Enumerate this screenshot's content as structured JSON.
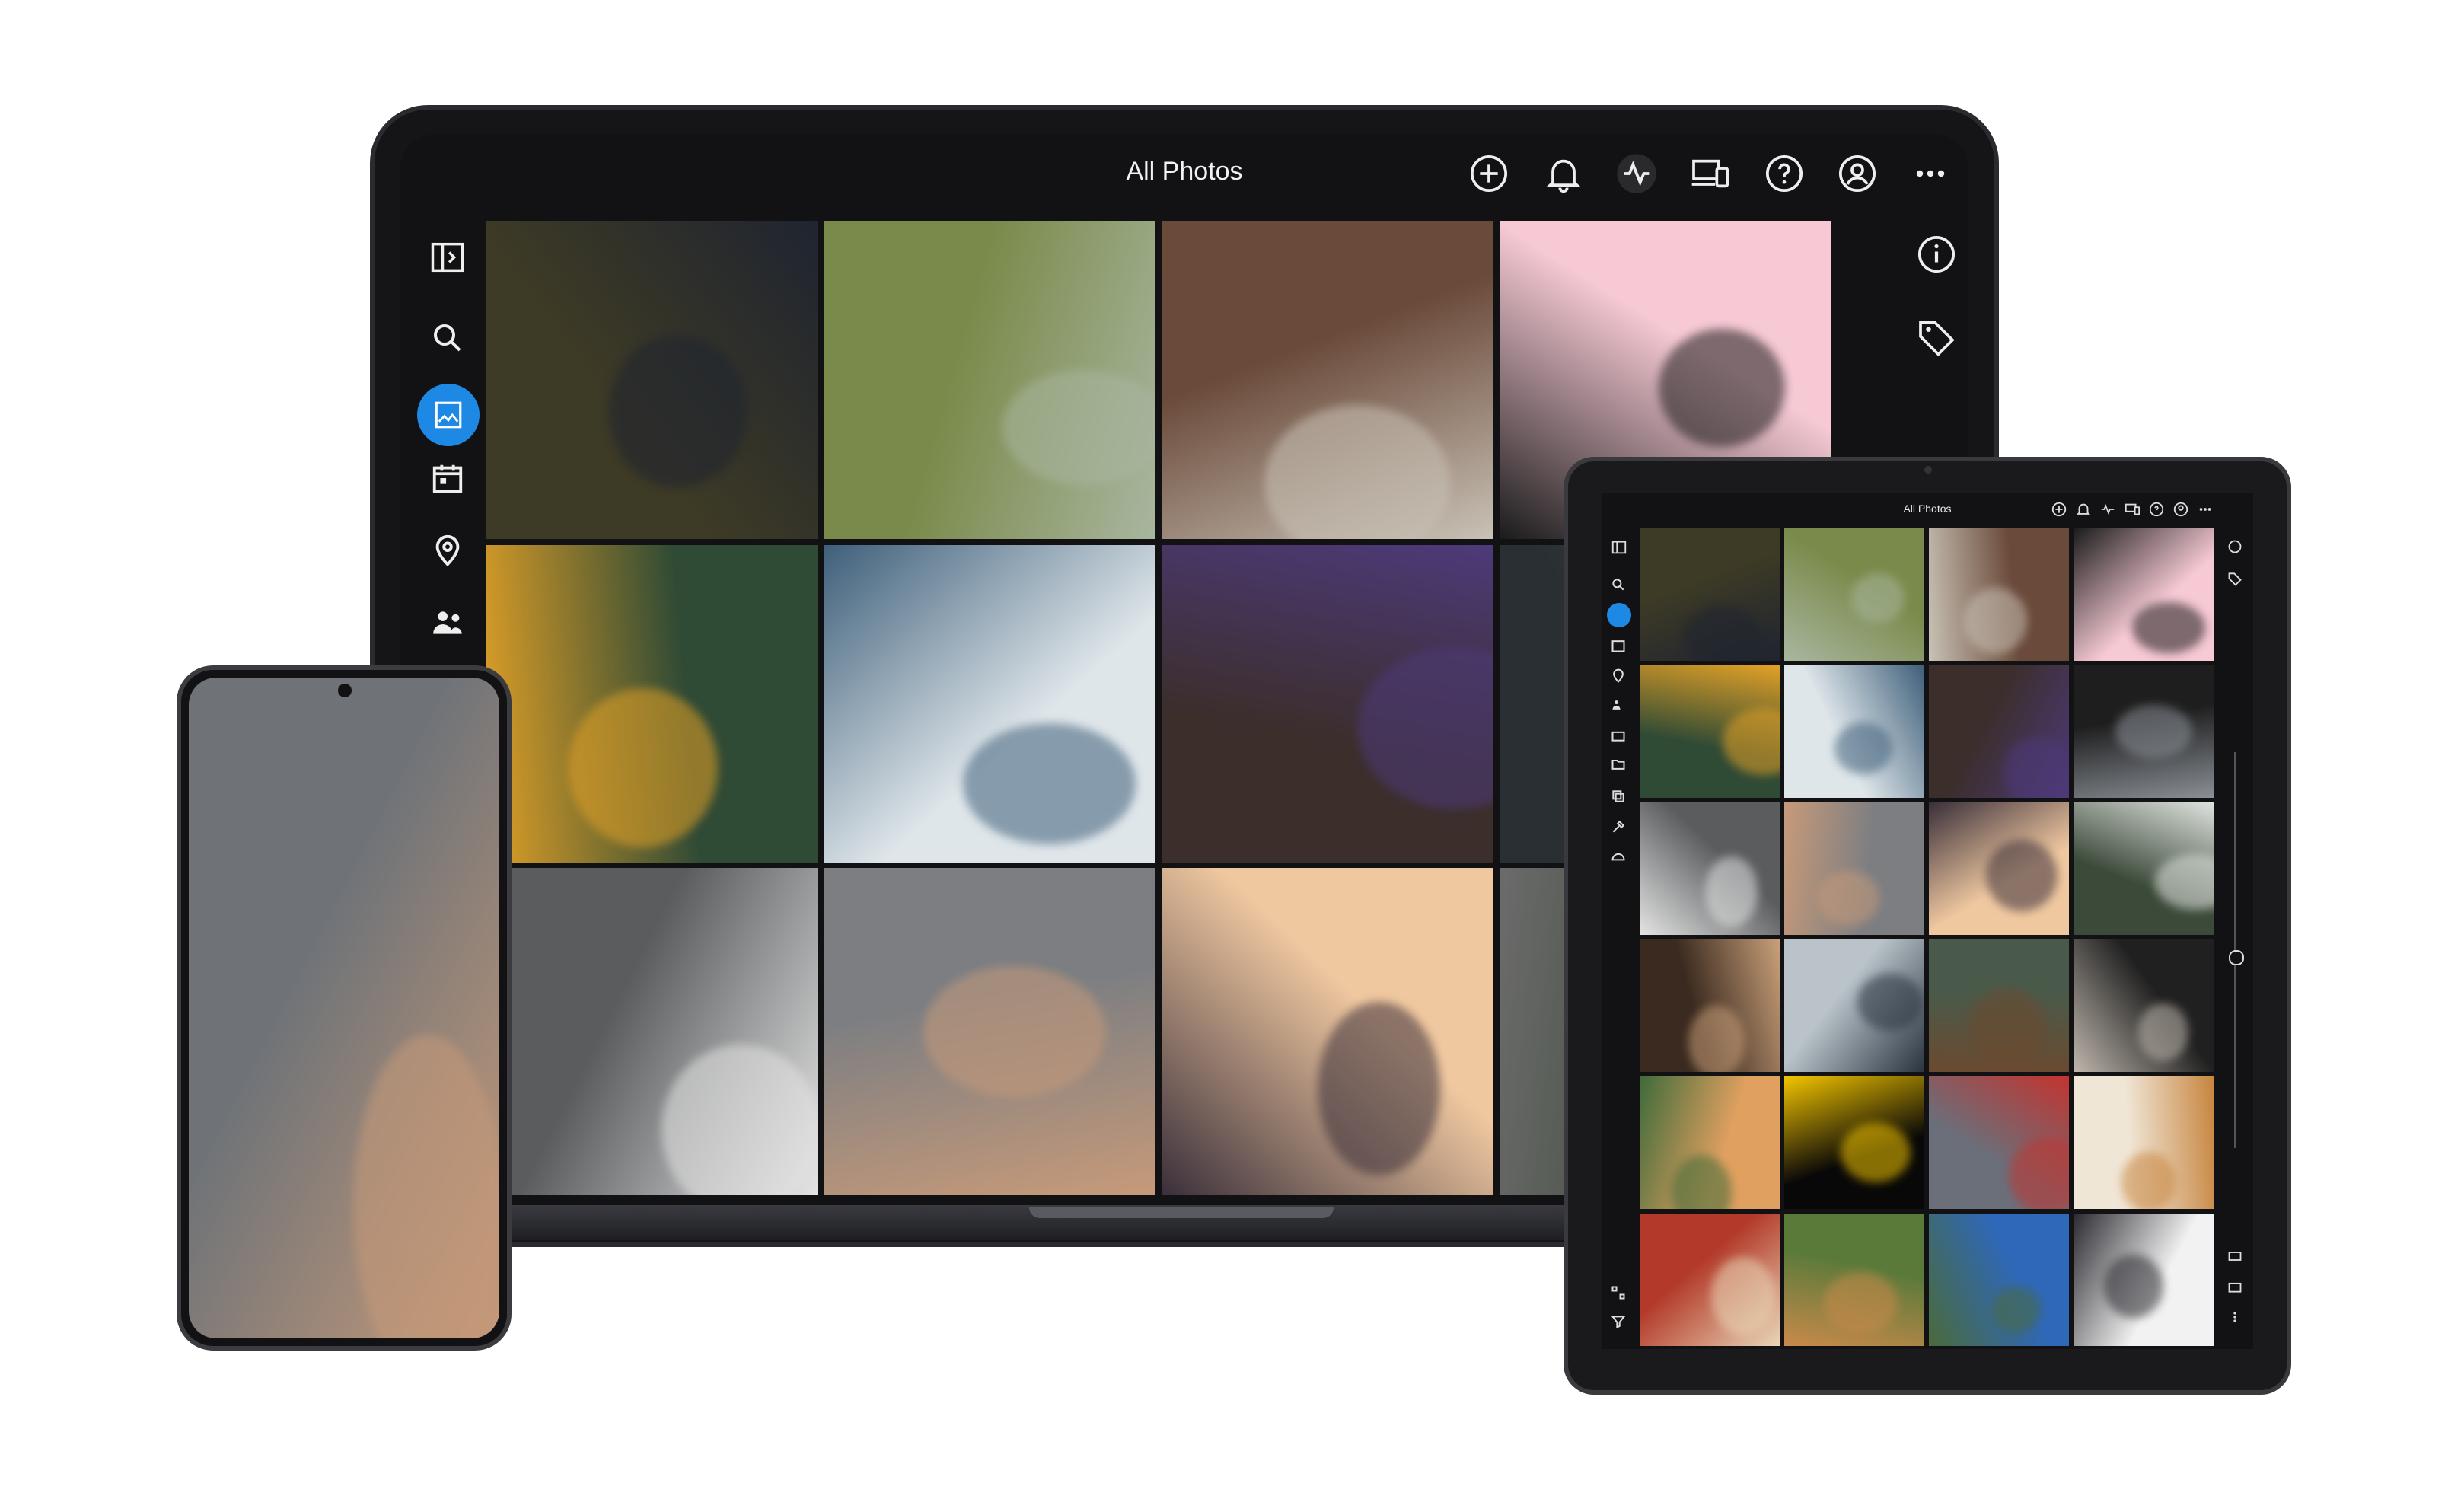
{
  "app": {
    "title": "All Photos",
    "accent": "#1e88e5"
  },
  "laptop": {
    "toolbar_icons": [
      "add-icon",
      "bell-icon",
      "activity-icon",
      "devices-icon",
      "help-icon",
      "account-icon",
      "more-icon"
    ],
    "sidebar_icons": [
      "sidebar-toggle-icon",
      "search-icon",
      "photos-icon",
      "calendar-icon",
      "location-icon",
      "people-icon"
    ],
    "right_icons": [
      "info-icon",
      "tag-icon"
    ],
    "photos": [
      {
        "name": "photo-bag-plant",
        "c1": "#3d3a25",
        "c2": "#1f2430"
      },
      {
        "name": "photo-woman-field",
        "c1": "#7a8a4a",
        "c2": "#a9b6a0"
      },
      {
        "name": "photo-white-dog",
        "c1": "#6a4a3a",
        "c2": "#c9c2b6"
      },
      {
        "name": "photo-camera-pink",
        "c1": "#f6c9d4",
        "c2": "#1b1b1b"
      },
      {
        "name": "photo-autumn-leaf",
        "c1": "#2f4a35",
        "c2": "#e3a126"
      },
      {
        "name": "photo-surfer-wave",
        "c1": "#dfe6ea",
        "c2": "#3e5f7a"
      },
      {
        "name": "photo-purple-flowers",
        "c1": "#3b2e2b",
        "c2": "#4d3a7a"
      },
      {
        "name": "photo-partial",
        "c1": "#2a2f33",
        "c2": "#4a5056"
      },
      {
        "name": "photo-sneaker-splash",
        "c1": "#5a5c5e",
        "c2": "#e4e4e4"
      },
      {
        "name": "photo-woman-frame",
        "c1": "#7c7e82",
        "c2": "#c79a79"
      },
      {
        "name": "photo-concert-light",
        "c1": "#f0c8a0",
        "c2": "#3a2f3a"
      },
      {
        "name": "photo-partial-2",
        "c1": "#3d4a3a",
        "c2": "#6b6b6b"
      }
    ]
  },
  "tablet": {
    "title": "All Photos",
    "photos": [
      {
        "name": "t-photo-1",
        "c1": "#3d3a25",
        "c2": "#1f2430"
      },
      {
        "name": "t-photo-2",
        "c1": "#7a8a4a",
        "c2": "#a9b6a0"
      },
      {
        "name": "t-photo-3",
        "c1": "#6a4a3a",
        "c2": "#c9c2b6"
      },
      {
        "name": "t-photo-4",
        "c1": "#f6c9d4",
        "c2": "#1b1b1b"
      },
      {
        "name": "t-photo-5",
        "c1": "#2f4a35",
        "c2": "#e3a126"
      },
      {
        "name": "t-photo-6",
        "c1": "#dfe6ea",
        "c2": "#3e5f7a"
      },
      {
        "name": "t-photo-7",
        "c1": "#3b2e2b",
        "c2": "#4d3a7a"
      },
      {
        "name": "t-photo-8",
        "c1": "#1e1e1e",
        "c2": "#8a8f96"
      },
      {
        "name": "t-photo-9",
        "c1": "#5a5c5e",
        "c2": "#e4e4e4"
      },
      {
        "name": "t-photo-10",
        "c1": "#7c7e82",
        "c2": "#c79a79"
      },
      {
        "name": "t-photo-11",
        "c1": "#f0c8a0",
        "c2": "#3a2f3a"
      },
      {
        "name": "t-photo-12",
        "c1": "#3c4a3a",
        "c2": "#dfe3de"
      },
      {
        "name": "t-photo-13",
        "c1": "#3a2a1f",
        "c2": "#caa07a"
      },
      {
        "name": "t-photo-14",
        "c1": "#b9c3c9",
        "c2": "#2a3440"
      },
      {
        "name": "t-photo-15",
        "c1": "#4a5a4a",
        "c2": "#6b4a30"
      },
      {
        "name": "t-photo-16",
        "c1": "#202020",
        "c2": "#bfb7ad"
      },
      {
        "name": "t-photo-17",
        "c1": "#e0a060",
        "c2": "#3e6b3a"
      },
      {
        "name": "t-photo-18",
        "c1": "#080808",
        "c2": "#f2c400"
      },
      {
        "name": "t-photo-19",
        "c1": "#6a6f7a",
        "c2": "#c3342f"
      },
      {
        "name": "t-photo-20",
        "c1": "#f0e6d6",
        "c2": "#c7853f"
      },
      {
        "name": "t-photo-21",
        "c1": "#b33a2a",
        "c2": "#e9d6b6"
      },
      {
        "name": "t-photo-22",
        "c1": "#5a7a3a",
        "c2": "#c98a4a"
      },
      {
        "name": "t-photo-23",
        "c1": "#2f68b8",
        "c2": "#4a6a3a"
      },
      {
        "name": "t-photo-24",
        "c1": "#f2f2f2",
        "c2": "#2a2a30"
      }
    ]
  },
  "phone": {
    "photo": {
      "name": "phone-photo-woman-frame",
      "c1": "#6f7378",
      "c2": "#c79a79"
    }
  }
}
